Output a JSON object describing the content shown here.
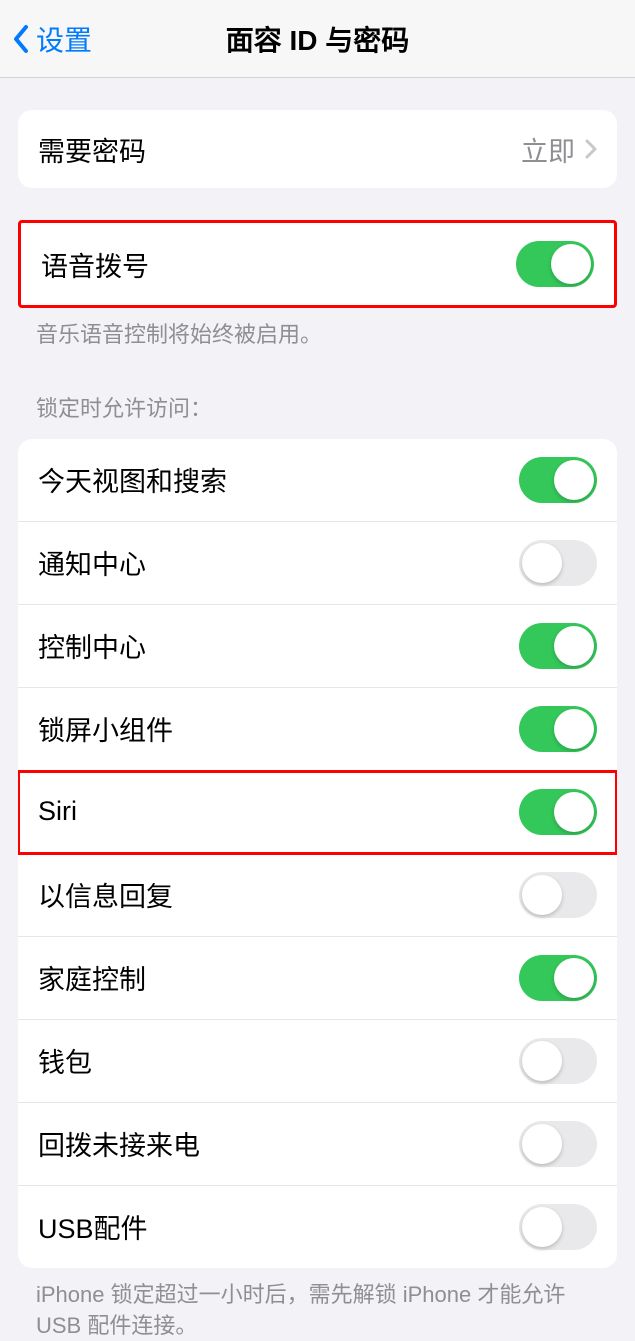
{
  "header": {
    "back_label": "设置",
    "title": "面容 ID 与密码"
  },
  "passcode_group": {
    "require_passcode": {
      "label": "需要密码",
      "value": "立即"
    }
  },
  "voice_dial_group": {
    "voice_dial": {
      "label": "语音拨号",
      "on": true
    },
    "footer": "音乐语音控制将始终被启用。"
  },
  "lock_access": {
    "header": "锁定时允许访问：",
    "items": [
      {
        "label": "今天视图和搜索",
        "on": true
      },
      {
        "label": "通知中心",
        "on": false
      },
      {
        "label": "控制中心",
        "on": true
      },
      {
        "label": "锁屏小组件",
        "on": true
      },
      {
        "label": "Siri",
        "on": true
      },
      {
        "label": "以信息回复",
        "on": false
      },
      {
        "label": "家庭控制",
        "on": true
      },
      {
        "label": "钱包",
        "on": false
      },
      {
        "label": "回拨未接来电",
        "on": false
      },
      {
        "label": "USB配件",
        "on": false
      }
    ],
    "footer": "iPhone 锁定超过一小时后，需先解锁 iPhone 才能允许 USB 配件连接。"
  },
  "highlights": {
    "voice_dial": true,
    "siri_index": 4
  }
}
